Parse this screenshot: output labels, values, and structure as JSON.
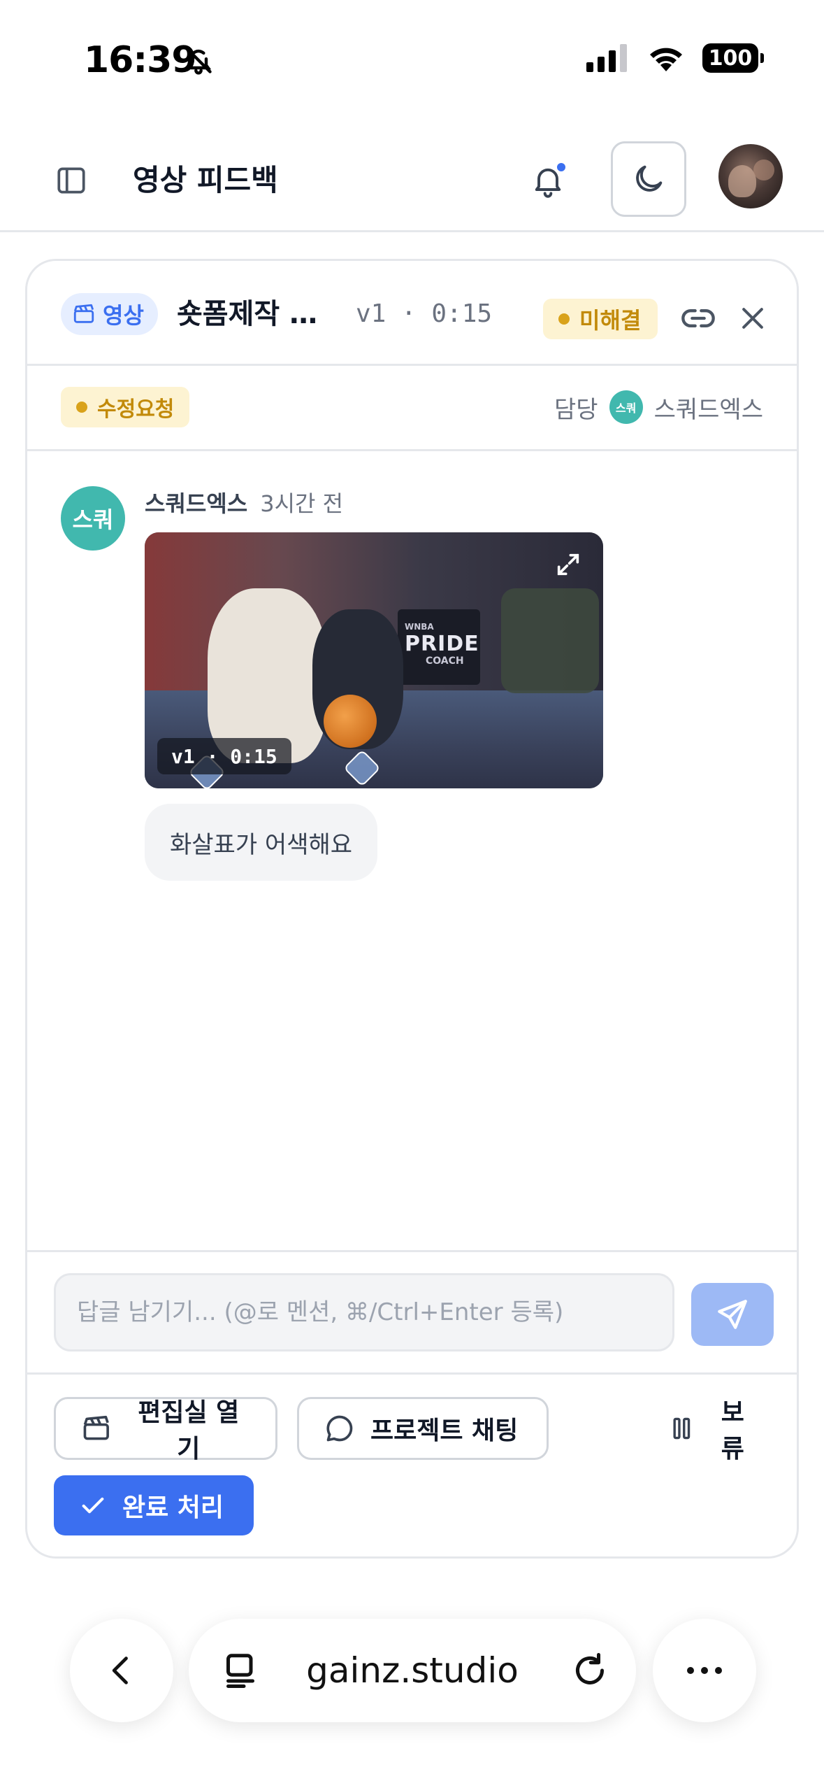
{
  "status_bar": {
    "time": "16:39",
    "battery": "100"
  },
  "header": {
    "title": "영상 피드백"
  },
  "card": {
    "type_badge": "영상",
    "title": "숏폼제작 프로젝트",
    "version_time": "v1 · 0:15",
    "resolution_status": "미해결",
    "status_tag": "수정요청",
    "assignee_label": "담당",
    "assignee_avatar": "스쿼",
    "assignee_name": "스쿼드엑스"
  },
  "comment": {
    "avatar": "스쿼",
    "author": "스쿼드엑스",
    "time": "3시간 전",
    "video_overlay": "v1 · 0:15",
    "thumbnail_text": {
      "league": "WNBA",
      "headline": "PRIDE",
      "sub": "COACH"
    },
    "message": "화살표가 어색해요"
  },
  "reply": {
    "placeholder": "답글 남기기... (@로 멘션, ⌘/Ctrl+Enter 등록)"
  },
  "actions": {
    "open_editroom": "편집실 열기",
    "project_chat": "프로젝트 채팅",
    "hold": "보류",
    "complete": "완료 처리"
  },
  "browser": {
    "url": "gainz.studio"
  },
  "colors": {
    "accent": "#3b6ff0",
    "teal_avatar": "#41b8ae",
    "amber_badge_bg": "#fdf3d2",
    "amber_badge_text": "#c28a0a"
  }
}
